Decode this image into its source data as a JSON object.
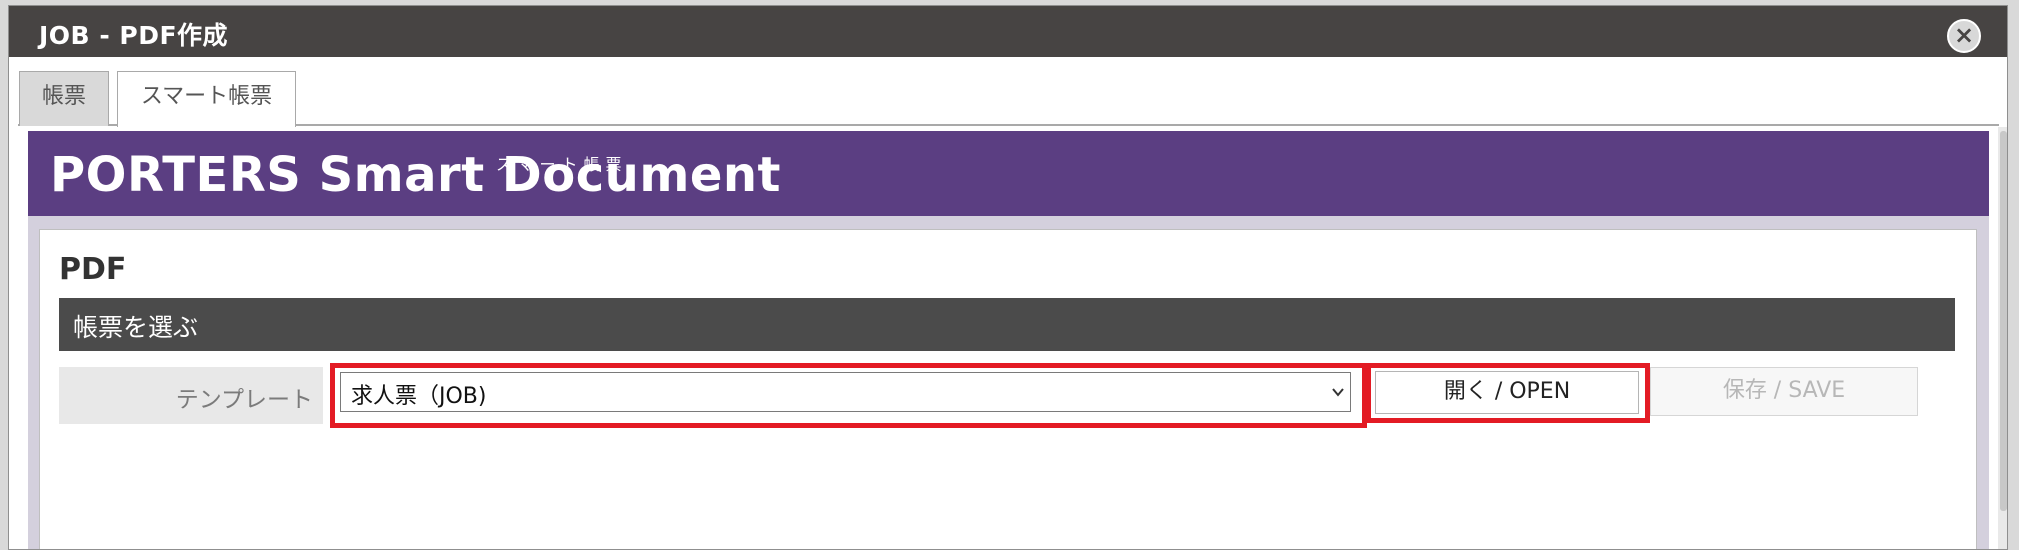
{
  "window": {
    "title": "JOB - PDF作成",
    "close_icon": "×"
  },
  "tabs": [
    {
      "label": "帳票"
    },
    {
      "label": "スマート帳票"
    }
  ],
  "banner": {
    "brand": "PORTERS Smart Document",
    "sub": "スマート帳票",
    "color": "#5b3e82"
  },
  "panel": {
    "heading": "PDF",
    "section_title": "帳票を選ぶ",
    "template_label": "テンプレート",
    "template_value": "求人票（JOB)",
    "open_button": "開く / OPEN",
    "save_button": "保存 / SAVE",
    "highlight_color": "#e31b24"
  }
}
